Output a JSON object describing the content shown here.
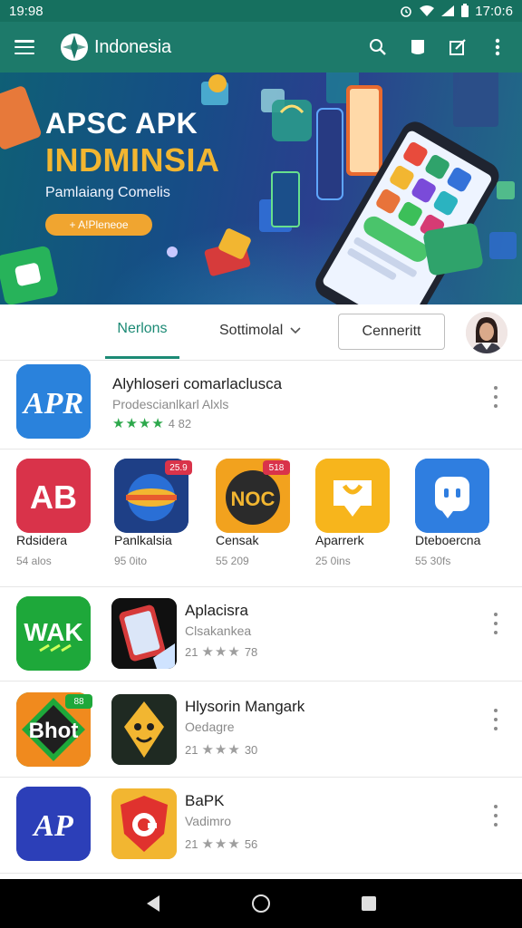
{
  "status_bar": {
    "time_left": "19:98",
    "time_right": "17:0:6"
  },
  "app_bar": {
    "title": "Indonesia"
  },
  "banner": {
    "headline_1": "APSC APK",
    "headline_2": "INDMINSIA",
    "subtitle": "Pamlaiang Comelis",
    "button_label": "+ A!Pleneoe"
  },
  "tabs": {
    "active_label": "Nerlons",
    "sort_label": "Sottimolal",
    "outline_button": "Cenneritt"
  },
  "featured": {
    "title": "Alyhloseri comarlaclusca",
    "subtitle": "Prodescianlkarl Alxls",
    "stars": "★★★★",
    "rating": "4 82"
  },
  "grid": [
    {
      "name": "Rdsidera",
      "size": "54 alos"
    },
    {
      "name": "Panlkalsia",
      "size": "95 0ito"
    },
    {
      "name": "Censak",
      "size": "55 209"
    },
    {
      "name": "Aparrerk",
      "size": "25 0ins"
    },
    {
      "name": "Dteboercna",
      "size": "55 30fs"
    }
  ],
  "grid_badges": [
    "25.9",
    "518"
  ],
  "list": [
    {
      "title": "Aplacisra",
      "subtitle": "Clsakankea",
      "meta_num": "21",
      "stars": "★★★",
      "meta_end": "78"
    },
    {
      "title": "Hlysorin Mangark",
      "subtitle": "Oedagre",
      "meta_num": "21",
      "stars": "★★★",
      "meta_end": "30"
    },
    {
      "title": "BaPK",
      "subtitle": "Vadimro",
      "meta_num": "21",
      "stars": "★★★",
      "meta_end": "56"
    }
  ],
  "icon_text": {
    "featured": "APR",
    "grid_1": "AB",
    "grid_3": "NOC",
    "list_1": "WAK",
    "list_2": "Bhot",
    "list_2_badge": "88",
    "list_3": "AP"
  },
  "colors": {
    "primary": "#1d7a6a",
    "accent_tab": "#1c8a75",
    "banner_yellow": "#f2b631",
    "banner_button": "#f0a530",
    "star_green": "#2ca84b"
  }
}
